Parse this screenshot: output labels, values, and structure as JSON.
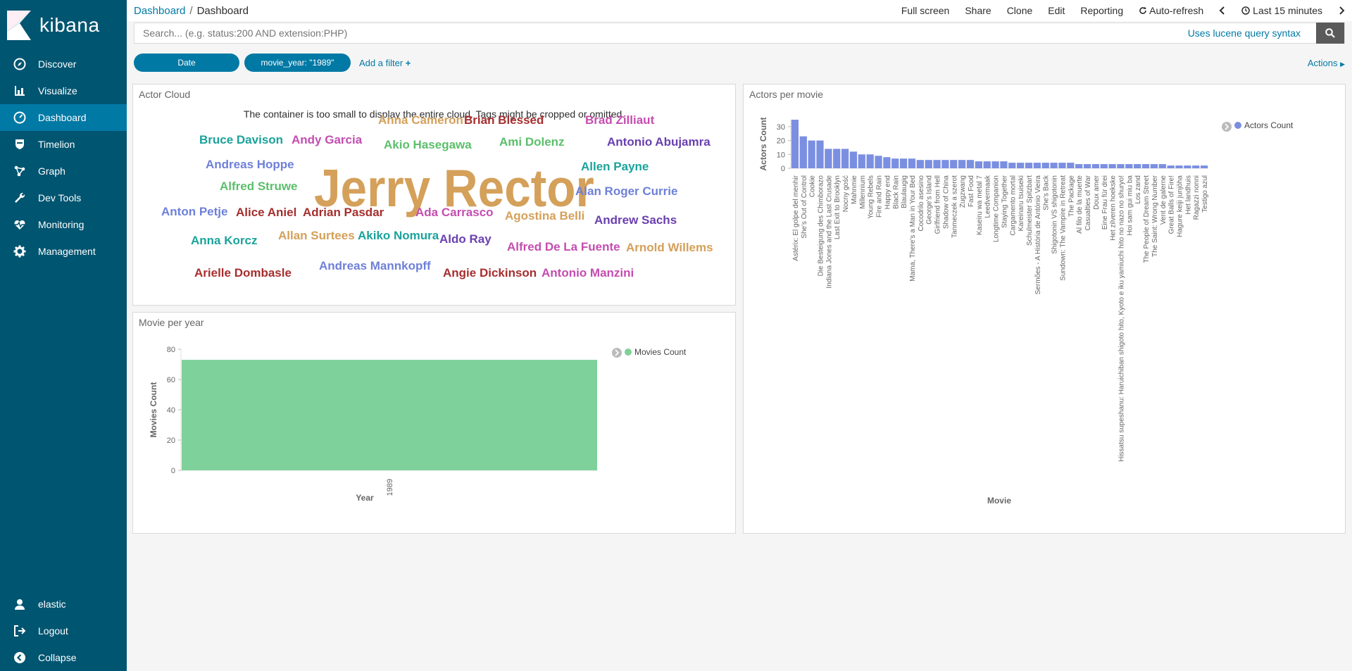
{
  "sidebar": {
    "brand": "kibana",
    "items": [
      {
        "label": "Discover",
        "icon": "compass-icon",
        "active": false
      },
      {
        "label": "Visualize",
        "icon": "bar-chart-icon",
        "active": false
      },
      {
        "label": "Dashboard",
        "icon": "dashboard-icon",
        "active": true
      },
      {
        "label": "Timelion",
        "icon": "shield-icon",
        "active": false
      },
      {
        "label": "Graph",
        "icon": "graph-icon",
        "active": false
      },
      {
        "label": "Dev Tools",
        "icon": "wrench-icon",
        "active": false
      },
      {
        "label": "Monitoring",
        "icon": "heartbeat-icon",
        "active": false
      },
      {
        "label": "Management",
        "icon": "gear-icon",
        "active": false
      }
    ],
    "bottom": [
      {
        "label": "elastic",
        "icon": "user-icon"
      },
      {
        "label": "Logout",
        "icon": "logout-icon"
      },
      {
        "label": "Collapse",
        "icon": "collapse-icon"
      }
    ]
  },
  "topbar": {
    "breadcrumb": [
      "Dashboard",
      "Dashboard"
    ],
    "actions": [
      "Full screen",
      "Share",
      "Clone",
      "Edit",
      "Reporting"
    ],
    "auto_refresh": "Auto-refresh",
    "time_range": "Last 15 minutes"
  },
  "search": {
    "placeholder": "Search... (e.g. status:200 AND extension:PHP)",
    "lucene": "Uses lucene query syntax"
  },
  "filters": {
    "pills": [
      "Date",
      "movie_year: \"1989\""
    ],
    "add_filter": "Add a filter",
    "actions": "Actions"
  },
  "colors": {
    "sidebar": "#005571",
    "active": "#0079a5",
    "link": "#0079a5",
    "bar_blue": "#7b8fe1",
    "bar_green": "#7fd19b"
  },
  "actor_cloud": {
    "title": "Actor Cloud",
    "warning": "The container is too small to display the entire cloud. Tags might be cropped or omitted.",
    "tags": [
      {
        "text": "Anna Cameron",
        "color": "#d4a05a"
      },
      {
        "text": "Brian Blessed",
        "color": "#a62e2e"
      },
      {
        "text": "Brad Zilliaut",
        "color": "#c44db0"
      },
      {
        "text": "Bruce Davison",
        "color": "#1aa39b"
      },
      {
        "text": "Andy Garcia",
        "color": "#c44db0"
      },
      {
        "text": "Akio Hasegawa",
        "color": "#5bbf6b"
      },
      {
        "text": "Ami Dolenz",
        "color": "#5bbf6b"
      },
      {
        "text": "Antonio Abujamra",
        "color": "#6a3fb0"
      },
      {
        "text": "Andreas Hoppe",
        "color": "#6e80d8"
      },
      {
        "text": "Jerry Rector",
        "color": "#d4a05a"
      },
      {
        "text": "Allen Payne",
        "color": "#1aa39b"
      },
      {
        "text": "Alfred Struwe",
        "color": "#5bbf6b"
      },
      {
        "text": "Alan Roger Currie",
        "color": "#6e80d8"
      },
      {
        "text": "Anton Petje",
        "color": "#6e80d8"
      },
      {
        "text": "Alice Aniel",
        "color": "#a62e2e"
      },
      {
        "text": "Adrian Pasdar",
        "color": "#a62e2e"
      },
      {
        "text": "Ada Carrasco",
        "color": "#c44db0"
      },
      {
        "text": "Agostina Belli",
        "color": "#d4a05a"
      },
      {
        "text": "Andrew Sachs",
        "color": "#6a3fb0"
      },
      {
        "text": "Anna Korcz",
        "color": "#1aa39b"
      },
      {
        "text": "Allan Surtees",
        "color": "#d4a05a"
      },
      {
        "text": "Akiko Nomura",
        "color": "#1aa39b"
      },
      {
        "text": "Aldo Ray",
        "color": "#6a3fb0"
      },
      {
        "text": "Alfred De La Fuente",
        "color": "#c44db0"
      },
      {
        "text": "Arnold Willems",
        "color": "#d4a05a"
      },
      {
        "text": "Arielle Dombasle",
        "color": "#a62e2e"
      },
      {
        "text": "Andreas Mannkopff",
        "color": "#6e80d8"
      },
      {
        "text": "Angie Dickinson",
        "color": "#a62e2e"
      },
      {
        "text": "Antonio Manzini",
        "color": "#c44db0"
      }
    ]
  },
  "movie_per_year": {
    "title": "Movie per year"
  },
  "actors_per_movie": {
    "title": "Actors per movie"
  },
  "chart_data": [
    {
      "type": "bar",
      "title": "Movie per year",
      "xlabel": "Year",
      "ylabel": "Movies Count",
      "categories": [
        "1989"
      ],
      "series": [
        {
          "name": "Movies Count",
          "values": [
            73
          ]
        }
      ],
      "ylim": [
        0,
        80
      ],
      "yticks": [
        0,
        20,
        40,
        60,
        80
      ],
      "legend": "top-right",
      "color": "#7fd19b"
    },
    {
      "type": "bar",
      "title": "Actors per movie",
      "xlabel": "Movie",
      "ylabel": "Actors Count",
      "categories": [
        "Astérix: El golpe del menhir",
        "She's Out of Control",
        "Cookie",
        "Die Besteigung des Chimborazo",
        "Indiana Jones and the Last Crusade",
        "Last Exit to Brooklyn",
        "Nocny gość",
        "Mahnmie",
        "Millennium",
        "Young Rebels",
        "Fire and Rain",
        "Happy end",
        "Black Rain",
        "Blaulaugig",
        "Mama, There's a Man in Your Bed",
        "Cocodrilo asesino",
        "George's Island",
        "Girlfriend from Hell",
        "Shadow of China",
        "Tanmeczek a szerot",
        "Zugzwang",
        "Fast Food",
        "Kaseiru wa metal 7",
        "Leedvermaak",
        "Longtime Companion",
        "Staying Together",
        "Cargamento mortal",
        "Kareinaru tsuiseki",
        "Schulmeister Spitzbart",
        "Sermões - A História de António Vieira",
        "She's Back",
        "Shigotonin VS shigotonin",
        "Sundown: The Vampire in Retreat",
        "The Package",
        "Al filo de la muerte",
        "Casualties of War",
        "Doux amer",
        "Eine Frau für drei",
        "Het zilveren hoekske",
        "Hissatsu supeshanu: Haruichiban shigoto hito, Kyoto e iku yamiuchi hito no nazo no shuryo!",
        "Hoi sam gui miu ba",
        "Los zand",
        "The People of Dream Street",
        "The Saint: Wrong Number",
        "Vent de galerne",
        "Great Balls of Fire!",
        "Hagure keiji junjōha",
        "Het landhuis",
        "Ragazzi nonni",
        "Testigo azul"
      ],
      "series": [
        {
          "name": "Actors Count",
          "values": [
            35,
            23,
            20,
            20,
            14,
            14,
            14,
            12,
            10,
            10,
            9,
            8,
            7,
            7,
            7,
            6,
            6,
            6,
            6,
            6,
            6,
            6,
            5,
            5,
            5,
            5,
            4,
            4,
            4,
            4,
            4,
            4,
            4,
            4,
            3,
            3,
            3,
            3,
            3,
            3,
            3,
            3,
            3,
            3,
            3,
            2,
            2,
            2,
            2,
            2
          ]
        }
      ],
      "ylim": [
        0,
        35
      ],
      "yticks": [
        0,
        10,
        20,
        30
      ],
      "legend": "top-right",
      "color": "#7b8fe1"
    }
  ]
}
